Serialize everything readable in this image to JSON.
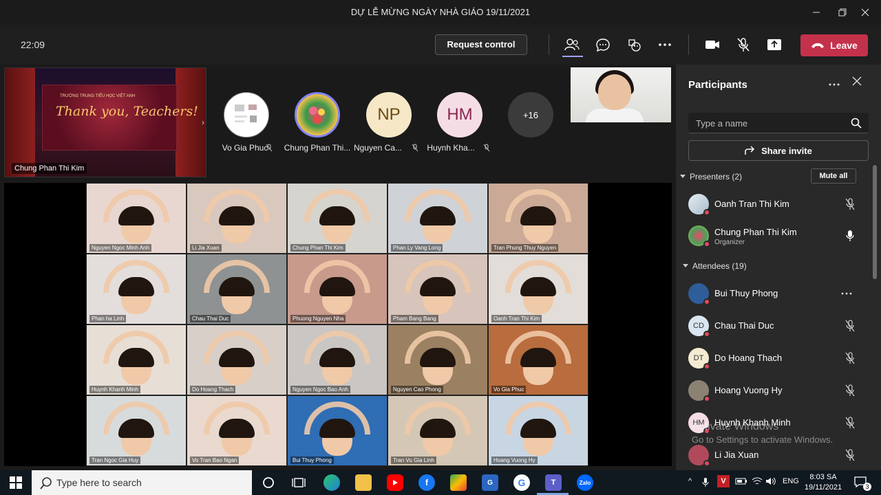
{
  "window": {
    "title": "DỰ LỄ MỪNG NGÀY NHÀ GIÁO 19/11/2021"
  },
  "toolbar": {
    "timer": "22:09",
    "request_control_label": "Request control",
    "leave_label": "Leave",
    "icons": [
      "people-icon",
      "chat-icon",
      "reactions-icon",
      "more-icon",
      "camera-icon",
      "mic-off-icon",
      "share-icon"
    ],
    "accent": "#9ea2ff",
    "leave_color": "#c4314b"
  },
  "stage": {
    "shared_content": {
      "school": "TRƯỜNG TRUNG TIỂU HỌC VIỆT ANH",
      "headline": "Thank you, Teachers!",
      "presenter_label": "Chung Phan Thi Kim"
    },
    "bubbles": [
      {
        "name": "Vo Gia Phuc",
        "initials": "",
        "color": "#ffffff"
      },
      {
        "name": "Chung Phan Thi...",
        "initials": "",
        "color": "#5b5fc7"
      },
      {
        "name": "Nguyen Ca...",
        "initials": "NP",
        "color": "#f6e7c7"
      },
      {
        "name": "Huynh Kha...",
        "initials": "HM",
        "color": "#f5dde6"
      },
      {
        "name": "",
        "initials": "+16",
        "color": "#3b3b3b"
      }
    ],
    "gallery": [
      {
        "name": "Nguyen Ngoc Minh Anh",
        "bg": "#e8d7d0"
      },
      {
        "name": "Li Jia Xuan",
        "bg": "#d9c8bd"
      },
      {
        "name": "Chung Phan Thi Kim",
        "bg": "#d6d4cf"
      },
      {
        "name": "Phan Ly Vang Long",
        "bg": "#cfd3d8"
      },
      {
        "name": "Tran Phung Thuy Nguyen",
        "bg": "#caa996"
      },
      {
        "name": "Phan ha Linh",
        "bg": "#e3dedc"
      },
      {
        "name": "Chau Thai Duc",
        "bg": "#8e9292"
      },
      {
        "name": "Phuong Nguyen Nha",
        "bg": "#c79a8c"
      },
      {
        "name": "Pham Bang Bang",
        "bg": "#d7c4ba"
      },
      {
        "name": "Oanh Tran Thi Kim",
        "bg": "#e2ddd8"
      },
      {
        "name": "Huynh Khanh Minh",
        "bg": "#e7ded6"
      },
      {
        "name": "Do Hoang Thach",
        "bg": "#d8cfc9"
      },
      {
        "name": "Nguyen Ngoc Bao Anh",
        "bg": "#c9c6c4"
      },
      {
        "name": "Nguyen Cao Phong",
        "bg": "#9b8061"
      },
      {
        "name": "Vo Gia Phuc",
        "bg": "#b96c3d"
      },
      {
        "name": "Tran Ngoc Gia Huy",
        "bg": "#d8dbdc"
      },
      {
        "name": "Vo Tran Bao Ngan",
        "bg": "#ead9cf"
      },
      {
        "name": "Bui Thuy Phong",
        "bg": "#2f6db4"
      },
      {
        "name": "Tran Vu Gia Linh",
        "bg": "#d5c7b5"
      },
      {
        "name": "Hoang Vuong Hy",
        "bg": "#c8d6e4"
      }
    ]
  },
  "participants": {
    "title": "Participants",
    "search_placeholder": "Type a name",
    "share_invite_label": "Share invite",
    "mute_all_label": "Mute all",
    "presenters_header": "Presenters (2)",
    "attendees_header": "Attendees (19)",
    "presenters": [
      {
        "name": "Oanh Tran Thi Kim",
        "role": "",
        "initials": "",
        "avatar_color": "#c9d6e0",
        "mic": "mic-off-icon"
      },
      {
        "name": "Chung Phan Thi Kim",
        "role": "Organizer",
        "initials": "",
        "avatar_color": "#b8455a",
        "mic": "mic-on-icon"
      }
    ],
    "attendees": [
      {
        "name": "Bui Thuy Phong",
        "initials": "",
        "avatar_color": "#2f5d9a",
        "mic": "more-icon"
      },
      {
        "name": "Chau Thai Duc",
        "initials": "CD",
        "avatar_color": "#d9e6f2",
        "mic": "mic-off-icon"
      },
      {
        "name": "Do Hoang Thach",
        "initials": "DT",
        "avatar_color": "#f4ecd2",
        "mic": "mic-off-icon"
      },
      {
        "name": "Hoang Vuong Hy",
        "initials": "",
        "avatar_color": "#8c8273",
        "mic": "mic-off-icon"
      },
      {
        "name": "Huynh Khanh Minh",
        "initials": "HM",
        "avatar_color": "#f5dde6",
        "mic": "mic-off-icon"
      },
      {
        "name": "Li Jia Xuan",
        "initials": "",
        "avatar_color": "#b04a5a",
        "mic": "mic-off-icon"
      }
    ]
  },
  "watermark": {
    "line1": "Activate Windows",
    "line2": "Go to Settings to activate Windows."
  },
  "taskbar": {
    "search_placeholder": "Type here to search",
    "language": "ENG",
    "time": "8:03 SA",
    "date": "19/11/2021",
    "notification_count": "3"
  }
}
